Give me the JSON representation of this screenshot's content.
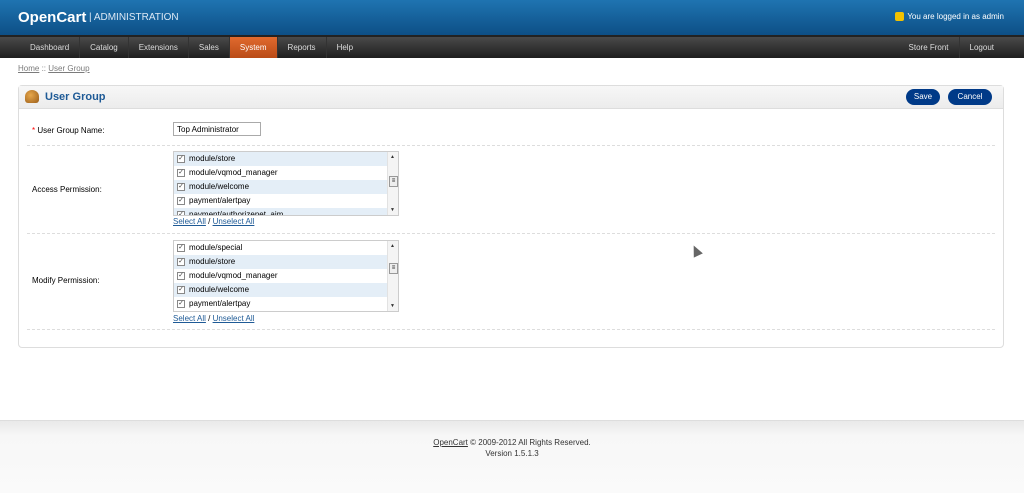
{
  "header": {
    "logo": "OpenCart",
    "subtitle": "| ADMINISTRATION",
    "login_text": "You are logged in as admin"
  },
  "nav": {
    "items": [
      "Dashboard",
      "Catalog",
      "Extensions",
      "Sales",
      "System",
      "Reports",
      "Help"
    ],
    "active": "System",
    "right": [
      "Store Front",
      "Logout"
    ]
  },
  "breadcrumb": {
    "home": "Home",
    "sep": " :: ",
    "current": "User Group"
  },
  "box": {
    "title": "User Group",
    "save": "Save",
    "cancel": "Cancel"
  },
  "form": {
    "name_label": "User Group Name:",
    "required": "* ",
    "name_value": "Top Administrator",
    "access_label": "Access Permission:",
    "modify_label": "Modify Permission:",
    "access_items": [
      "module/store",
      "module/vqmod_manager",
      "module/welcome",
      "payment/alertpay",
      "payment/authorizenet_aim"
    ],
    "modify_items": [
      "module/special",
      "module/store",
      "module/vqmod_manager",
      "module/welcome",
      "payment/alertpay"
    ],
    "select_all": "Select All",
    "slash": " / ",
    "unselect_all": "Unselect All"
  },
  "footer": {
    "link": "OpenCart",
    "copyright": " © 2009-2012 All Rights Reserved.",
    "version": "Version 1.5.1.3"
  }
}
